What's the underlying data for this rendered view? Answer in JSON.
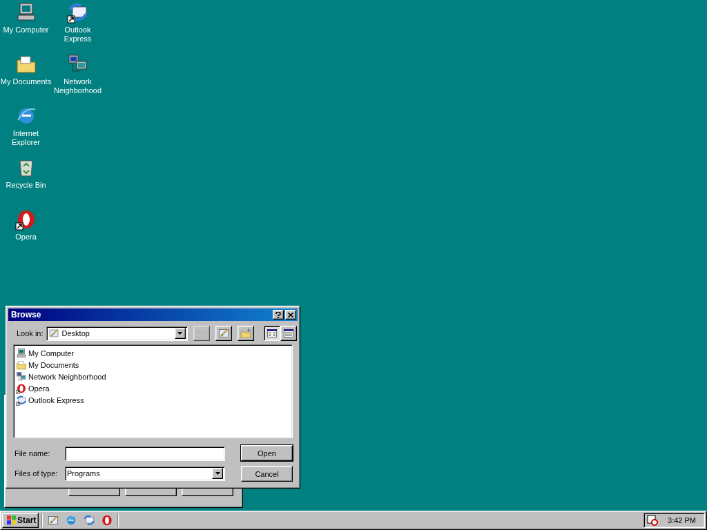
{
  "desktop_icons": [
    {
      "label": "My Computer",
      "kind": "computer",
      "shortcut": false
    },
    {
      "label": "My Documents",
      "kind": "documents",
      "shortcut": false
    },
    {
      "label": "Internet Explorer",
      "kind": "ie",
      "shortcut": false
    },
    {
      "label": "Recycle Bin",
      "kind": "recycle",
      "shortcut": false
    },
    {
      "label": "Opera",
      "kind": "opera",
      "shortcut": true
    },
    {
      "label": "Outlook Express",
      "kind": "outlook",
      "shortcut": true
    },
    {
      "label": "Network Neighborhood",
      "kind": "network",
      "shortcut": false
    }
  ],
  "dialog": {
    "title": "Browse",
    "look_in": {
      "label": "Look in:",
      "value": "Desktop",
      "kind": "desktop"
    },
    "toolbar": [
      {
        "kind": "up",
        "disabled": true,
        "selected": false
      },
      {
        "kind": "desktop",
        "disabled": false,
        "selected": false
      },
      {
        "kind": "newfolder",
        "disabled": false,
        "selected": false
      },
      {
        "kind": "list",
        "disabled": false,
        "selected": true
      },
      {
        "kind": "details",
        "disabled": false,
        "selected": false
      }
    ],
    "files": [
      {
        "name": "My Computer",
        "kind": "computer",
        "shortcut": false
      },
      {
        "name": "My Documents",
        "kind": "documents",
        "shortcut": false
      },
      {
        "name": "Network Neighborhood",
        "kind": "network",
        "shortcut": false
      },
      {
        "name": "Opera",
        "kind": "opera",
        "shortcut": true
      },
      {
        "name": "Outlook Express",
        "kind": "outlook",
        "shortcut": true
      }
    ],
    "file_name": {
      "label": "File name:"
    },
    "file_type": {
      "label": "Files of type:",
      "value": "Programs"
    },
    "buttons": [
      {
        "label": "Open",
        "default": true
      },
      {
        "label": "Cancel",
        "default": false
      }
    ]
  },
  "taskbar": {
    "start": "Start",
    "quick_launch": [
      {
        "kind": "desktop"
      },
      {
        "kind": "ie"
      },
      {
        "kind": "outlook"
      },
      {
        "kind": "opera"
      }
    ],
    "time": "3:42 PM"
  }
}
